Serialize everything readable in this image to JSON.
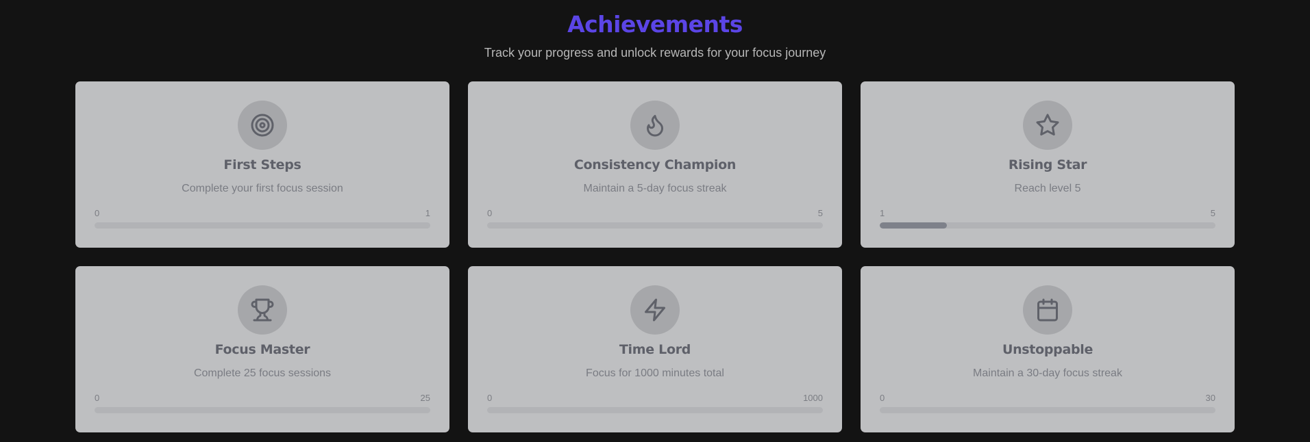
{
  "header": {
    "title": "Achievements",
    "subtitle": "Track your progress and unlock rewards for your focus journey"
  },
  "achievements": [
    {
      "icon": "target-icon",
      "title": "First Steps",
      "description": "Complete your first focus session",
      "current": "0",
      "goal": "1",
      "progress_fraction": 0
    },
    {
      "icon": "flame-icon",
      "title": "Consistency Champion",
      "description": "Maintain a 5-day focus streak",
      "current": "0",
      "goal": "5",
      "progress_fraction": 0
    },
    {
      "icon": "star-icon",
      "title": "Rising Star",
      "description": "Reach level 5",
      "current": "1",
      "goal": "5",
      "progress_fraction": 0.2
    },
    {
      "icon": "trophy-icon",
      "title": "Focus Master",
      "description": "Complete 25 focus sessions",
      "current": "0",
      "goal": "25",
      "progress_fraction": 0
    },
    {
      "icon": "lightning-icon",
      "title": "Time Lord",
      "description": "Focus for 1000 minutes total",
      "current": "0",
      "goal": "1000",
      "progress_fraction": 0
    },
    {
      "icon": "calendar-icon",
      "title": "Unstoppable",
      "description": "Maintain a 30-day focus streak",
      "current": "0",
      "goal": "30",
      "progress_fraction": 0
    }
  ]
}
